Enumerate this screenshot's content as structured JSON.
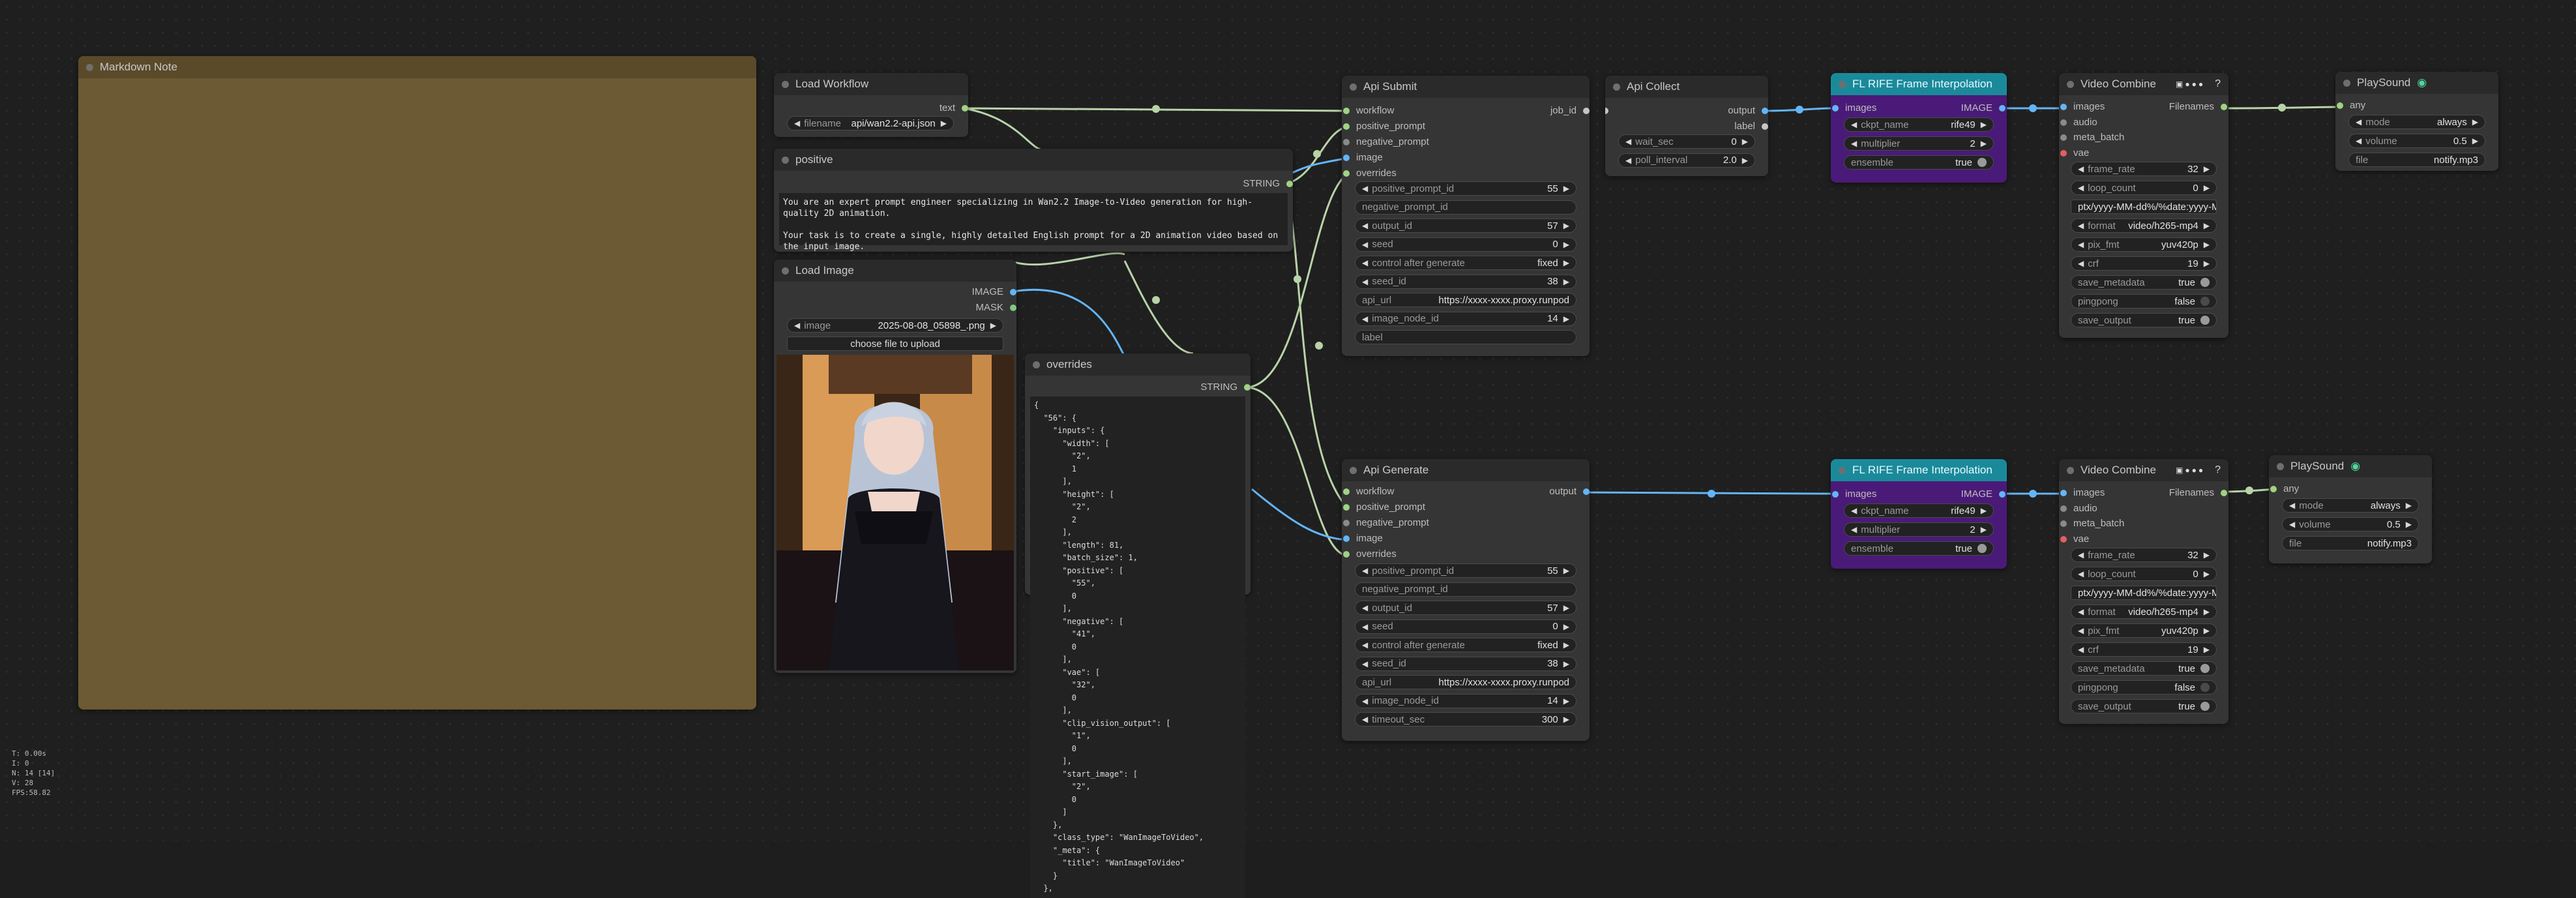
{
  "colors": {
    "string_pin": "#a1d283",
    "image_pin": "#64b5f6",
    "vae_pin": "#e25f5f",
    "json_pin": "#c5c5c5",
    "wire_green": "#b9d3a8",
    "wire_blue": "#64b5f6"
  },
  "markdown_note": {
    "title": "Markdown Note",
    "bg": "#6b5a33"
  },
  "load_workflow": {
    "title": "Load Workflow",
    "out_text": "text",
    "filename_label": "filename",
    "filename_value": "api/wan2.2-api.json"
  },
  "positive": {
    "title": "positive",
    "out": "STRING",
    "text": "You are an expert prompt engineer specializing in Wan2.2 Image-to-Video generation for high-quality 2D animation.\n\nYour task is to create a single, highly detailed English prompt for a 2D animation video based on the input image."
  },
  "load_image": {
    "title": "Load Image",
    "out_image": "IMAGE",
    "out_mask": "MASK",
    "image_label": "image",
    "image_value": "2025-08-08_05898_.png",
    "upload": "choose file to upload"
  },
  "overrides": {
    "title": "overrides",
    "out": "STRING",
    "code": [
      "{",
      "  \"56\": {",
      "    \"inputs\": {",
      "      \"width\": [",
      "        \"2\",",
      "        1",
      "      ],",
      "      \"height\": [",
      "        \"2\",",
      "        2",
      "      ],",
      "      \"length\": 81,",
      "      \"batch_size\": 1,",
      "      \"positive\": [",
      "        \"55\",",
      "        0",
      "      ],",
      "      \"negative\": [",
      "        \"41\",",
      "        0",
      "      ],",
      "      \"vae\": [",
      "        \"32\",",
      "        0",
      "      ],",
      "      \"clip_vision_output\": [",
      "        \"1\",",
      "        0",
      "      ],",
      "      \"start_image\": [",
      "        \"2\",",
      "        0",
      "      ]",
      "    },",
      "    \"class_type\": \"WanImageToVideo\",",
      "    \"_meta\": {",
      "      \"title\": \"WanImageToVideo\"",
      "    }",
      "  },"
    ]
  },
  "api_submit": {
    "title": "Api Submit",
    "inputs": [
      "workflow",
      "positive_prompt",
      "negative_prompt",
      "image",
      "overrides"
    ],
    "output": "job_id",
    "widgets": [
      {
        "label": "positive_prompt_id",
        "value": "55"
      },
      {
        "label": "negative_prompt_id",
        "value": ""
      },
      {
        "label": "output_id",
        "value": "57"
      },
      {
        "label": "seed",
        "value": "0"
      },
      {
        "label": "control after generate",
        "value": "fixed"
      },
      {
        "label": "seed_id",
        "value": "38"
      },
      {
        "label": "api_url",
        "value": "https://xxxx-xxxx.proxy.runpod"
      },
      {
        "label": "image_node_id",
        "value": "14"
      },
      {
        "label": "label",
        "value": ""
      }
    ]
  },
  "api_collect": {
    "title": "Api Collect",
    "out1": "output",
    "out2": "label",
    "widgets": [
      {
        "label": "wait_sec",
        "value": "0"
      },
      {
        "label": "poll_interval",
        "value": "2.0"
      }
    ]
  },
  "api_generate": {
    "title": "Api Generate",
    "inputs": [
      "workflow",
      "positive_prompt",
      "negative_prompt",
      "image",
      "overrides"
    ],
    "output": "output",
    "widgets": [
      {
        "label": "positive_prompt_id",
        "value": "55"
      },
      {
        "label": "negative_prompt_id",
        "value": ""
      },
      {
        "label": "output_id",
        "value": "57"
      },
      {
        "label": "seed",
        "value": "0"
      },
      {
        "label": "control after generate",
        "value": "fixed"
      },
      {
        "label": "seed_id",
        "value": "38"
      },
      {
        "label": "api_url",
        "value": "https://xxxx-xxxx.proxy.runpod"
      },
      {
        "label": "image_node_id",
        "value": "14"
      },
      {
        "label": "timeout_sec",
        "value": "300"
      }
    ]
  },
  "rife_1": {
    "title": "FL RIFE Frame Interpolation",
    "in": "images",
    "out": "IMAGE",
    "widgets": [
      {
        "label": "ckpt_name",
        "value": "rife49"
      },
      {
        "label": "multiplier",
        "value": "2"
      },
      {
        "label": "ensemble",
        "value": "true"
      }
    ]
  },
  "rife_2": {
    "title": "FL RIFE Frame Interpolation",
    "in": "images",
    "out": "IMAGE",
    "widgets": [
      {
        "label": "ckpt_name",
        "value": "rife49"
      },
      {
        "label": "multiplier",
        "value": "2"
      },
      {
        "label": "ensemble",
        "value": "true"
      }
    ]
  },
  "video_combine_1": {
    "title": "Video Combine",
    "out": "Filenames",
    "inputs": [
      "images",
      "audio",
      "meta_batch",
      "vae"
    ],
    "widgets": [
      {
        "label": "frame_rate",
        "value": "32"
      },
      {
        "label": "loop_count",
        "value": "0"
      },
      {
        "label": "",
        "value": "ptx/yyyy-MM-dd%/%date:yyyy-M"
      },
      {
        "label": "format",
        "value": "video/h265-mp4"
      },
      {
        "label": "pix_fmt",
        "value": "yuv420p"
      },
      {
        "label": "crf",
        "value": "19"
      },
      {
        "label": "save_metadata",
        "value": "true"
      },
      {
        "label": "pingpong",
        "value": "false"
      },
      {
        "label": "save_output",
        "value": "true"
      }
    ]
  },
  "video_combine_2": {
    "title": "Video Combine",
    "out": "Filenames",
    "inputs": [
      "images",
      "audio",
      "meta_batch",
      "vae"
    ],
    "widgets": [
      {
        "label": "frame_rate",
        "value": "32"
      },
      {
        "label": "loop_count",
        "value": "0"
      },
      {
        "label": "",
        "value": "ptx/yyyy-MM-dd%/%date:yyyy-M"
      },
      {
        "label": "format",
        "value": "video/h265-mp4"
      },
      {
        "label": "pix_fmt",
        "value": "yuv420p"
      },
      {
        "label": "crf",
        "value": "19"
      },
      {
        "label": "save_metadata",
        "value": "true"
      },
      {
        "label": "pingpong",
        "value": "false"
      },
      {
        "label": "save_output",
        "value": "true"
      }
    ]
  },
  "playsound_1": {
    "title": "PlaySound",
    "in": "any",
    "widgets": [
      {
        "label": "mode",
        "value": "always"
      },
      {
        "label": "volume",
        "value": "0.5"
      },
      {
        "label": "file",
        "value": "notify.mp3"
      }
    ]
  },
  "playsound_2": {
    "title": "PlaySound",
    "in": "any",
    "widgets": [
      {
        "label": "mode",
        "value": "always"
      },
      {
        "label": "volume",
        "value": "0.5"
      },
      {
        "label": "file",
        "value": "notify.mp3"
      }
    ]
  },
  "stats": [
    "T: 0.00s",
    "I: 0",
    "N: 14 [14]",
    "V: 28",
    "FPS:58.82"
  ]
}
